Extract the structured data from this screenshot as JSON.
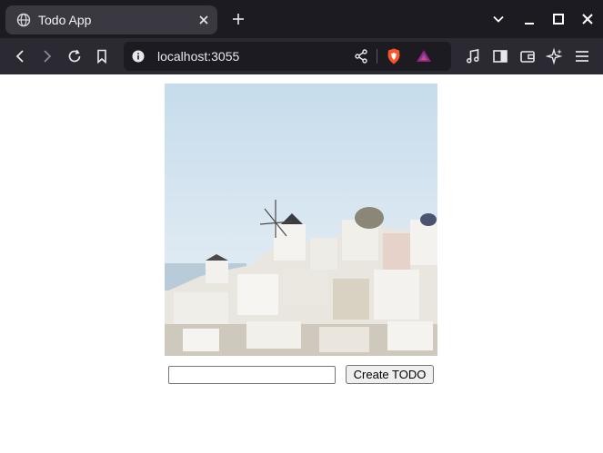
{
  "browser": {
    "tab": {
      "title": "Todo App",
      "favicon_icon": "globe-icon",
      "close_icon": "close-icon"
    },
    "new_tab_icon": "plus-icon",
    "window_controls": [
      "chevron-down-icon",
      "minimize-icon",
      "maximize-icon",
      "close-icon"
    ],
    "toolbar": {
      "nav_icons": [
        "back-icon",
        "forward-icon",
        "reload-icon",
        "bookmark-icon"
      ],
      "url": "localhost:3055",
      "url_icons": [
        "info-icon",
        "share-icon",
        "brave-shield-icon",
        "rewards-icon"
      ],
      "right_icons": [
        "media-icon",
        "sidebar-icon",
        "wallet-icon",
        "leo-ai-icon",
        "menu-icon"
      ]
    },
    "colors": {
      "tabbar_bg": "#1c1b22",
      "toolbar_bg": "#2b2a33",
      "brave_orange": "#fb542b"
    }
  },
  "page": {
    "image": {
      "description_icon": "santorini-photo",
      "sky_color": "#d3e3ef"
    },
    "form": {
      "input_value": "",
      "input_placeholder": "",
      "button_label": "Create TODO"
    }
  }
}
